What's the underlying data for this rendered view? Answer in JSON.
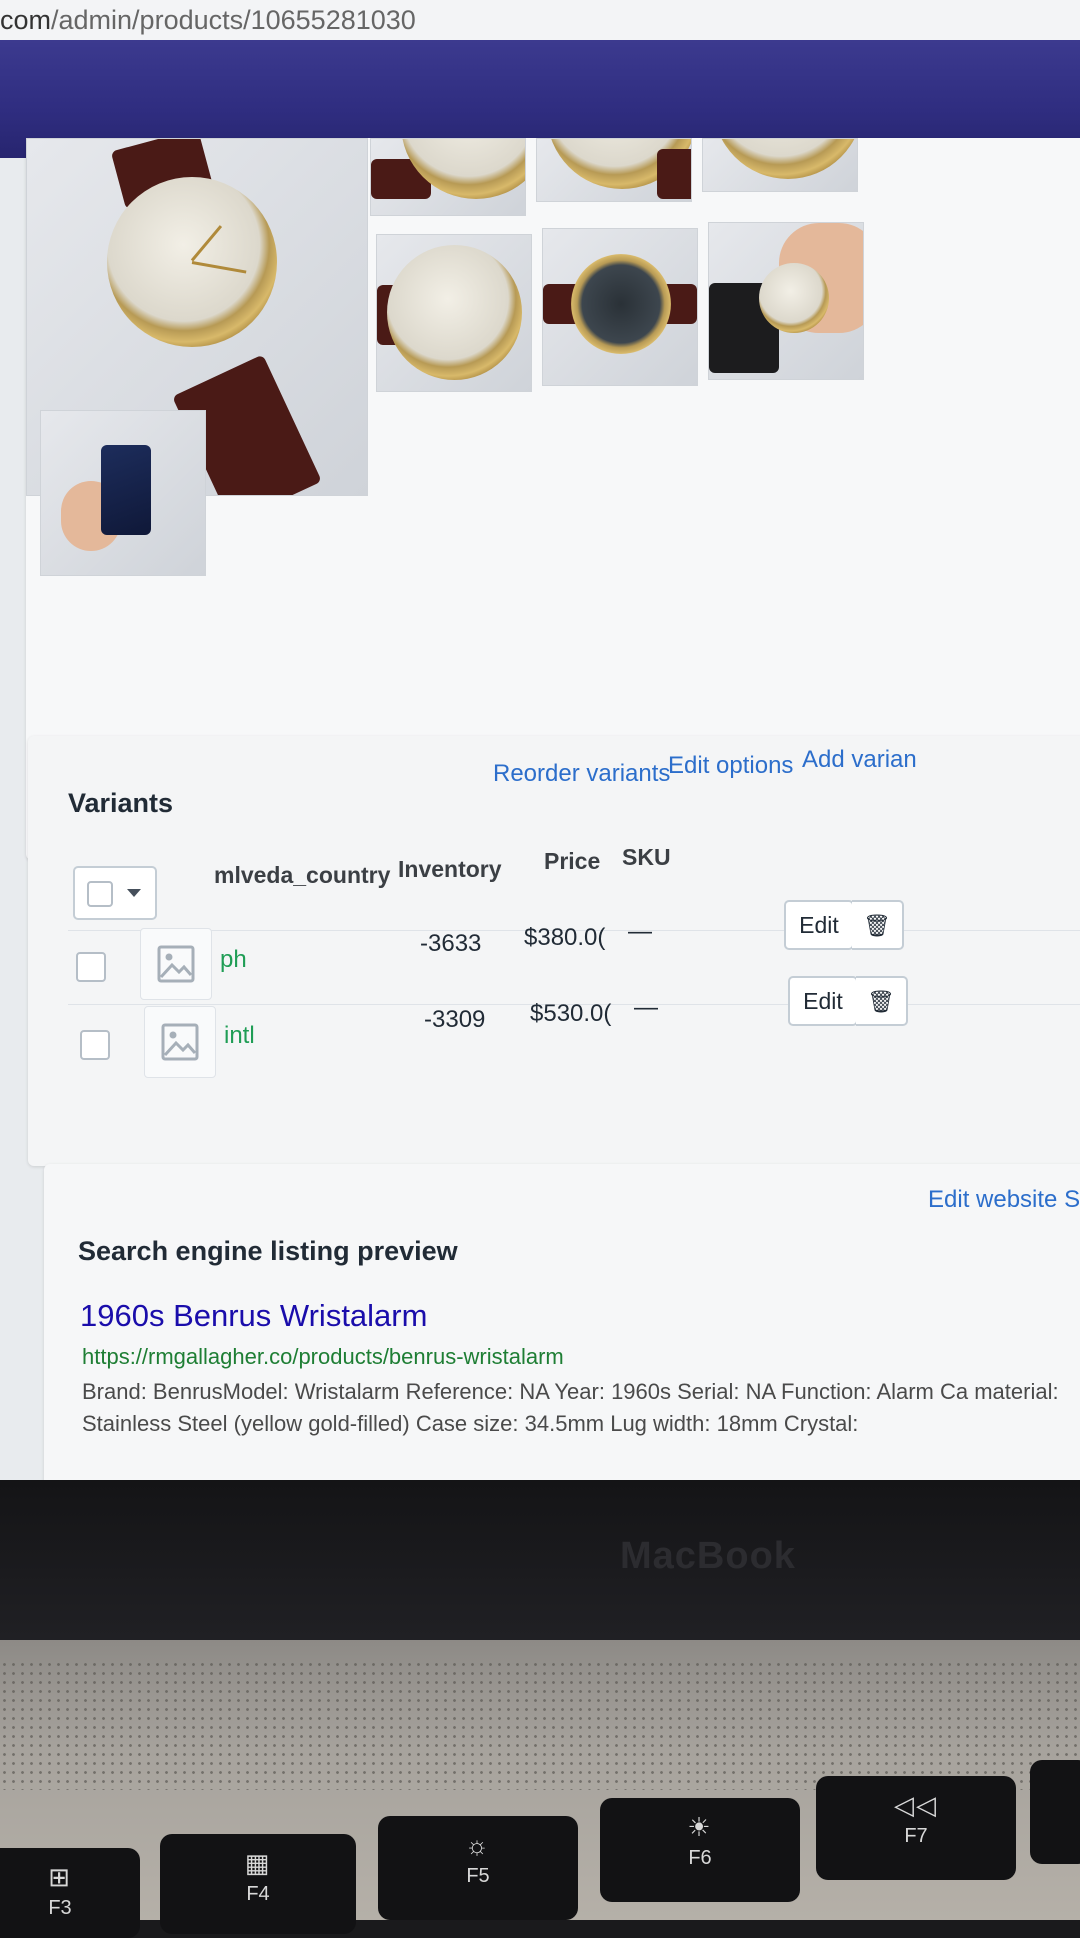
{
  "browser": {
    "url_host": "com",
    "url_path": "/admin/products/10655281030"
  },
  "variants": {
    "title": "Variants",
    "actions": [
      "Reorder variants",
      "Edit options",
      "Add varian"
    ],
    "headers": {
      "option": "mlveda_country",
      "inventory": "Inventory",
      "price": "Price",
      "sku": "SKU"
    },
    "rows": [
      {
        "option": "ph",
        "inventory": "-3633",
        "price": "$380.0(",
        "sku": "—",
        "edit": "Edit"
      },
      {
        "option": "intl",
        "inventory": "-3309",
        "price": "$530.0(",
        "sku": "—",
        "edit": "Edit"
      }
    ]
  },
  "seo": {
    "title": "Search engine listing preview",
    "edit_link": "Edit website S",
    "page_title": "1960s Benrus Wristalarm",
    "url": "https://rmgallagher.co/products/benrus-wristalarm",
    "description": "Brand: BenrusModel: Wristalarm Reference: NA Year: 1960s Serial: NA Function: Alarm Ca material: Stainless Steel (yellow gold-filled) Case size: 34.5mm Lug width: 18mm Crystal:"
  },
  "laptop": {
    "brand": "MacBook",
    "keys": [
      {
        "glyph": "⊞",
        "label": "F3",
        "icon": "mission-control-icon"
      },
      {
        "glyph": "▦",
        "label": "F4",
        "icon": "launchpad-icon"
      },
      {
        "glyph": "☼",
        "label": "F5",
        "icon": "keyboard-brightness-down-icon"
      },
      {
        "glyph": "☀",
        "label": "F6",
        "icon": "keyboard-brightness-up-icon"
      },
      {
        "glyph": "◁◁",
        "label": "F7",
        "icon": "rewind-icon"
      }
    ]
  }
}
